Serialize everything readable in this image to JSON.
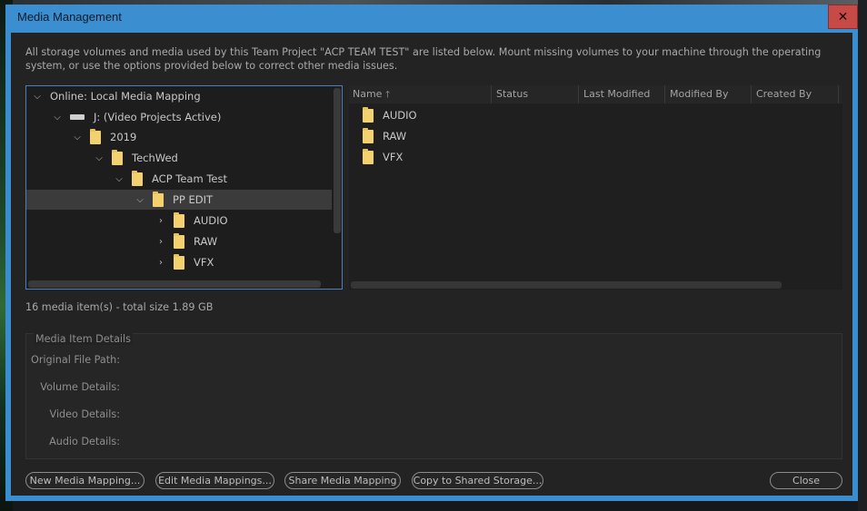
{
  "window": {
    "title": "Media Management",
    "close_glyph": "✕"
  },
  "intro_text": "All storage volumes and media used by this Team Project \"ACP TEAM TEST\" are listed below. Mount missing volumes to your machine through the operating system, or use the options provided below to correct other media issues.",
  "tree": {
    "items": [
      {
        "label": "Online: Local Media Mapping",
        "icon": "none",
        "expanded": true
      },
      {
        "label": "J: (Video Projects Active)",
        "icon": "drive-icon",
        "expanded": true
      },
      {
        "label": "2019",
        "icon": "folder-icon",
        "expanded": true
      },
      {
        "label": "TechWed",
        "icon": "folder-icon",
        "expanded": true
      },
      {
        "label": "ACP Team Test",
        "icon": "folder-icon",
        "expanded": true
      },
      {
        "label": "PP EDIT",
        "icon": "folder-icon",
        "expanded": true,
        "selected": true
      },
      {
        "label": "AUDIO",
        "icon": "folder-icon",
        "expanded": false
      },
      {
        "label": "RAW",
        "icon": "folder-icon",
        "expanded": false
      },
      {
        "label": "VFX",
        "icon": "folder-icon",
        "expanded": false
      }
    ]
  },
  "list": {
    "columns": [
      "Name",
      "Status",
      "Last Modified",
      "Modified By",
      "Created By"
    ],
    "sort_glyph": "🡑",
    "rows": [
      {
        "name": "AUDIO"
      },
      {
        "name": "RAW"
      },
      {
        "name": "VFX"
      }
    ]
  },
  "summary": "16 media item(s) - total size 1.89 GB",
  "details": {
    "legend": "Media Item Details",
    "labels": [
      "Original File Path:",
      "Volume Details:",
      "Video Details:",
      "Audio Details:"
    ]
  },
  "buttons": {
    "new_mapping": "New Media Mapping...",
    "edit_mappings": "Edit Media Mappings...",
    "share_mapping": "Share Media Mapping",
    "copy_shared": "Copy to Shared Storage...",
    "close": "Close"
  },
  "colors": {
    "titlebar": "#3b8fd1",
    "close_button": "#c74a47",
    "folder": "#f2d16e",
    "selection": "#3b3b3b"
  }
}
